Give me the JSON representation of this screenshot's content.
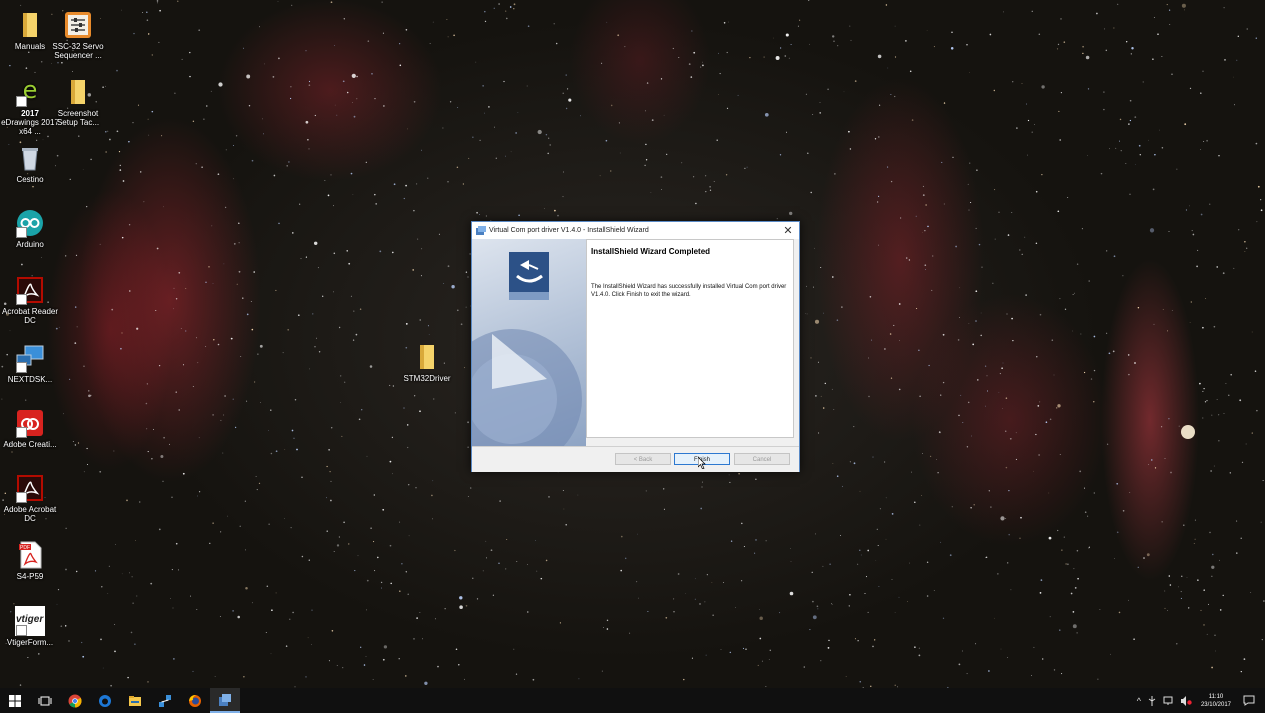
{
  "desktop": {
    "icons": [
      {
        "label": "Manuals",
        "icon": "folder-icon"
      },
      {
        "label": "SSC-32 Servo Sequencer ...",
        "icon": "servo-sequencer-app-icon"
      },
      {
        "label": "eDrawings 2017 x64 ...",
        "icon": "edrawings-app-icon",
        "badge": "2017"
      },
      {
        "label": "Screenshot Setup Tac...",
        "icon": "folder-icon"
      },
      {
        "label": "Cestino",
        "icon": "recycle-bin-icon"
      },
      {
        "label": "Arduino",
        "icon": "arduino-app-icon"
      },
      {
        "label": "Acrobat Reader DC",
        "icon": "acrobat-reader-icon"
      },
      {
        "label": "NEXTDSK...",
        "icon": "network-computer-icon"
      },
      {
        "label": "Adobe Creati...",
        "icon": "adobe-creative-cloud-icon"
      },
      {
        "label": "Adobe Acrobat DC",
        "icon": "acrobat-dc-icon"
      },
      {
        "label": "S4-P59",
        "icon": "pdf-file-icon",
        "badge": "PDF"
      },
      {
        "label": "VtigerForm...",
        "icon": "vtiger-app-icon",
        "badge": "vtiger"
      },
      {
        "label": "STM32Driver",
        "icon": "folder-icon"
      }
    ]
  },
  "dialog": {
    "title": "Virtual Com port driver V1.4.0 - InstallShield Wizard",
    "close_glyph": "✕",
    "heading": "InstallShield Wizard Completed",
    "message": "The InstallShield Wizard has successfully installed Virtual Com port driver V1.4.0. Click Finish to exit the wizard.",
    "buttons": {
      "back": "< Back",
      "finish": "Finish",
      "cancel": "Cancel"
    }
  },
  "taskbar": {
    "items": [
      "windows-start-icon",
      "task-view-icon",
      "chrome-icon",
      "edge-icon",
      "file-explorer-icon",
      "network-app-icon",
      "firefox-icon",
      "installer-icon"
    ],
    "tray": {
      "chevron": "^",
      "time": "11:10",
      "date": "23/10/2017"
    }
  },
  "colors": {
    "taskbar": "#101010",
    "dialog_border": "#5a8ac6",
    "finish_border": "#2c78d0"
  }
}
